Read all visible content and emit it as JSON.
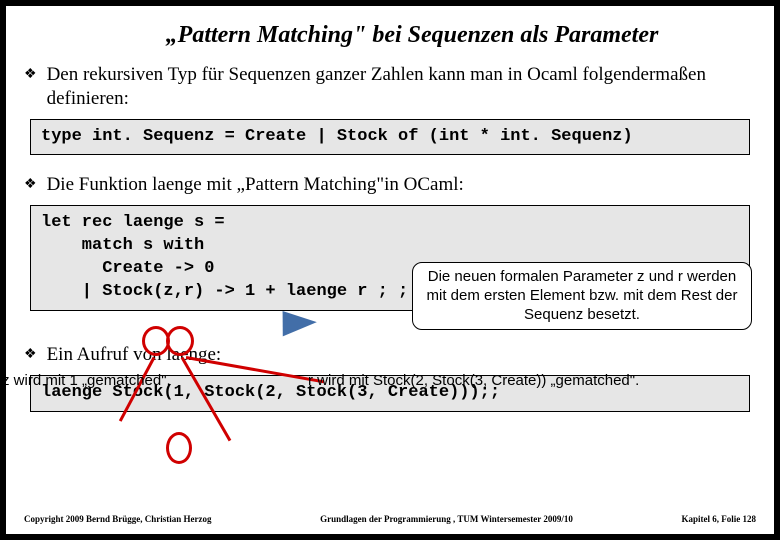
{
  "title": "„Pattern Matching\" bei Sequenzen als Parameter",
  "bullets": {
    "b1": "Den rekursiven  Typ für Sequenzen ganzer Zahlen kann man in Ocaml folgendermaßen definieren:",
    "b2": "Die Funktion laenge mit „Pattern Matching\"in OCaml:",
    "b3": "Ein Aufruf von laenge:"
  },
  "code": {
    "typedef": "type int. Sequenz = Create | Stock of (int * int. Sequenz)",
    "laenge": "let rec laenge s =\n    match s with\n      Create -> 0\n    | Stock(z,r) -> 1 + laenge r ; ;",
    "call": "laenge Stock(1, Stock(2, Stock(3, Create)));;"
  },
  "callout": "Die neuen formalen Parameter z und r werden mit dem ersten Element bzw. mit dem Rest der Sequenz besetzt.",
  "notes": {
    "left": "z wird mit 1 „gematched\".",
    "right": "r wird mit Stock(2, Stock(3, Create)) „gematched\"."
  },
  "footer": {
    "left": "Copyright 2009 Bernd Brügge, Christian Herzog",
    "mid": "Grundlagen der Programmierung ,   TUM Wintersemester 2009/10",
    "right": "Kapitel 6, Folie 128"
  }
}
